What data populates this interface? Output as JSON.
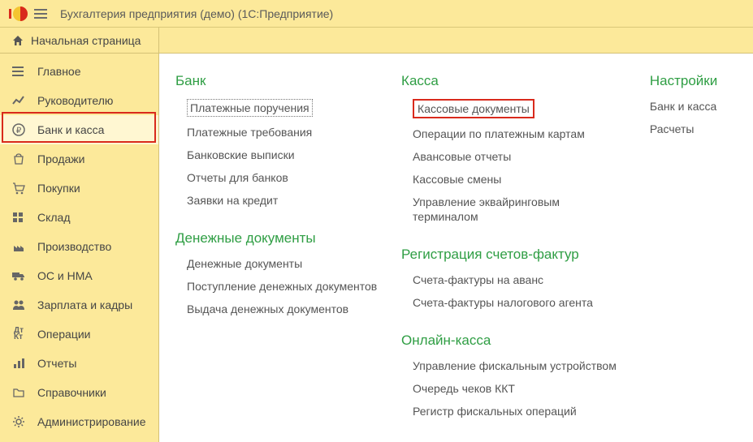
{
  "titlebar": {
    "title": "Бухгалтерия предприятия (демо)  (1С:Предприятие)"
  },
  "home": {
    "label": "Начальная страница"
  },
  "sidebar": {
    "items": [
      {
        "label": "Главное"
      },
      {
        "label": "Руководителю"
      },
      {
        "label": "Банк и касса"
      },
      {
        "label": "Продажи"
      },
      {
        "label": "Покупки"
      },
      {
        "label": "Склад"
      },
      {
        "label": "Производство"
      },
      {
        "label": "ОС и НМА"
      },
      {
        "label": "Зарплата и кадры"
      },
      {
        "label": "Операции"
      },
      {
        "label": "Отчеты"
      },
      {
        "label": "Справочники"
      },
      {
        "label": "Администрирование"
      }
    ]
  },
  "content": {
    "col1": {
      "sec1": {
        "title": "Банк",
        "links": [
          "Платежные поручения",
          "Платежные требования",
          "Банковские выписки",
          "Отчеты для банков",
          "Заявки на кредит"
        ]
      },
      "sec2": {
        "title": "Денежные документы",
        "links": [
          "Денежные документы",
          "Поступление денежных документов",
          "Выдача денежных документов"
        ]
      }
    },
    "col2": {
      "sec1": {
        "title": "Касса",
        "links": [
          "Кассовые документы",
          "Операции по платежным картам",
          "Авансовые отчеты",
          "Кассовые смены",
          "Управление эквайринговым терминалом"
        ]
      },
      "sec2": {
        "title": "Регистрация счетов-фактур",
        "links": [
          "Счета-фактуры на аванс",
          "Счета-фактуры налогового агента"
        ]
      },
      "sec3": {
        "title": "Онлайн-касса",
        "links": [
          "Управление фискальным устройством",
          "Очередь чеков ККТ",
          "Регистр фискальных операций"
        ]
      }
    },
    "col3": {
      "sec1": {
        "title": "Настройки",
        "links": [
          "Банк и касса",
          "Расчеты"
        ]
      }
    }
  }
}
